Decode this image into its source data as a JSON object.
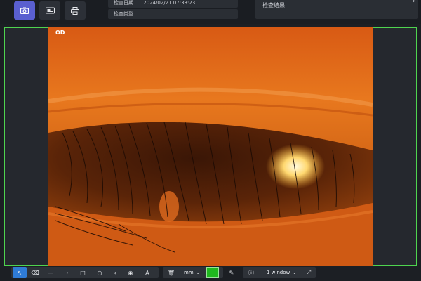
{
  "header": {
    "exam_date_label": "检查日期",
    "exam_date_value": "2024/02/21 07:33:23",
    "exam_type_label": "检查类型",
    "exam_result_label": "检查结果"
  },
  "viewer": {
    "eye_side": "OD",
    "frame_color": "#4fd44f"
  },
  "toolbar": {
    "unit": "mm",
    "annotation_color": "#1fb81f",
    "layout": "1 window"
  },
  "icons": {
    "camera": "camera-icon",
    "video": "video-icon",
    "print": "print-icon",
    "select": "cursor-icon",
    "eraser": "eraser-icon",
    "line": "line-icon",
    "arrow": "arrow-icon",
    "rect": "rectangle-icon",
    "circle": "circle-icon",
    "angle": "angle-icon",
    "eye": "eye-icon",
    "text": "text-icon",
    "delete": "trash-icon",
    "pen": "pen-icon",
    "info": "info-icon",
    "fullscreen": "fullscreen-icon"
  }
}
